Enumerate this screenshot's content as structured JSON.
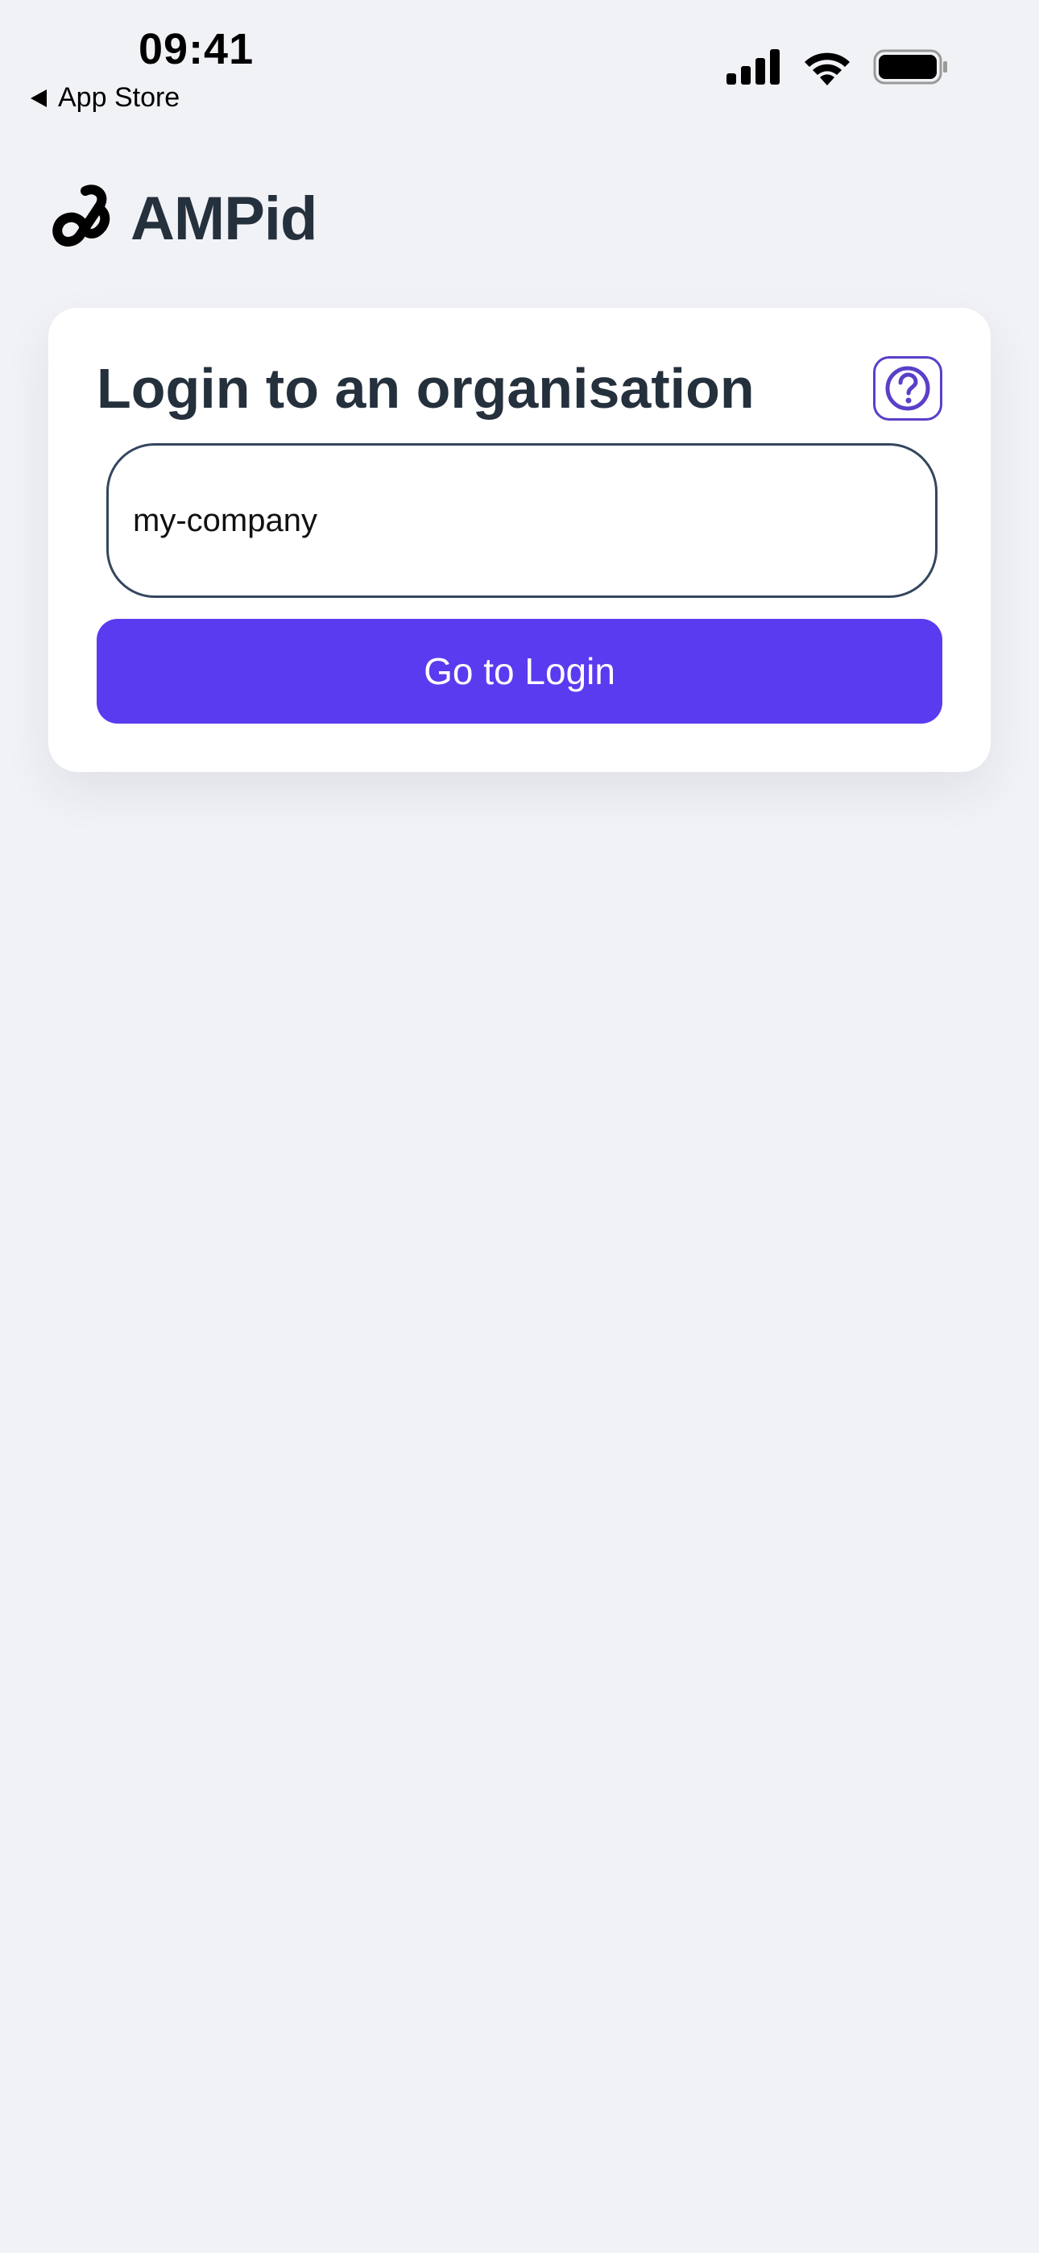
{
  "status_bar": {
    "time": "09:41",
    "back_label": "App Store",
    "icons": [
      "cellular-signal-icon",
      "wifi-icon",
      "battery-icon"
    ]
  },
  "brand": {
    "name": "AMPid",
    "logo_icon": "ampid-logo-icon"
  },
  "login_card": {
    "title": "Login to an organisation",
    "help_icon": "question-mark-icon",
    "org_input_value": "my-company",
    "submit_label": "Go to Login"
  },
  "colors": {
    "background": "#f1f2f6",
    "primary": "#5b3bef",
    "help_accent": "#5b3fc8",
    "text_dark": "#25303d",
    "input_border": "#34465f"
  }
}
